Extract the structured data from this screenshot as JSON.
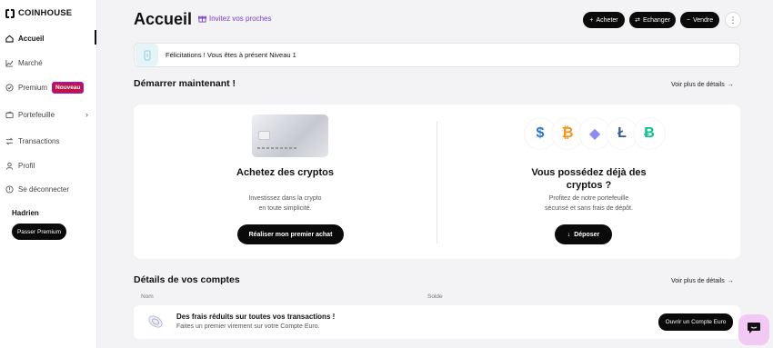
{
  "brand": {
    "name": "COINHOUSE"
  },
  "sidebar": {
    "items": [
      {
        "label": "Accueil",
        "icon": "home-icon"
      },
      {
        "label": "Marché",
        "icon": "chart-icon"
      },
      {
        "label": "Premium",
        "icon": "premium-icon",
        "badge": "Nouveau"
      },
      {
        "label": "Portefeuille",
        "icon": "wallet-icon"
      },
      {
        "label": "Transactions",
        "icon": "transfer-icon"
      },
      {
        "label": "Profil",
        "icon": "user-icon"
      },
      {
        "label": "Se déconnecter",
        "icon": "logout-icon"
      }
    ],
    "user_name": "Hadrien",
    "premium_button": "Passer Premium"
  },
  "header": {
    "title": "Accueil",
    "invite": "Invitez vos proches",
    "buttons": {
      "buy": "Acheter",
      "exchange": "Echanger",
      "sell": "Vendre"
    }
  },
  "notice": {
    "text": "Félicitations ! Vous êtes à présent Niveau 1"
  },
  "start": {
    "title": "Démarrer maintenant !",
    "more": "Voir plus de détails",
    "left": {
      "title": "Achetez des cryptos",
      "sub_line1": "Investissez dans la crypto",
      "sub_line2": "en toute simplicité.",
      "button": "Réaliser mon premier achat"
    },
    "right": {
      "title_line1": "Vous possédez déjà des",
      "title_line2": "cryptos ?",
      "sub_line1": "Profitez de notre portefeuille",
      "sub_line2": "sécurisé et sans frais de dépôt.",
      "button": "Déposer"
    },
    "coins": [
      {
        "symbol": "$",
        "color": "#2775ca"
      },
      {
        "symbol": "₿",
        "color": "#f7931a"
      },
      {
        "symbol": "◆",
        "color": "#8c8cf0"
      },
      {
        "symbol": "Ł",
        "color": "#345d9d"
      },
      {
        "symbol": "Ƀ",
        "color": "#0ac18e"
      }
    ]
  },
  "accounts": {
    "title": "Détails de vos comptes",
    "more": "Voir plus de détails",
    "col_name": "Nom",
    "col_balance": "Solde",
    "promo_title": "Des frais réduits sur toutes vos transactions !",
    "promo_sub": "Faites un premier virement sur votre Compte Euro.",
    "promo_button": "Ouvrir un Compte Euro"
  },
  "colors": {
    "accent": "#7a3ccf",
    "badge": "#c0134c",
    "dark": "#0a0a0a"
  }
}
